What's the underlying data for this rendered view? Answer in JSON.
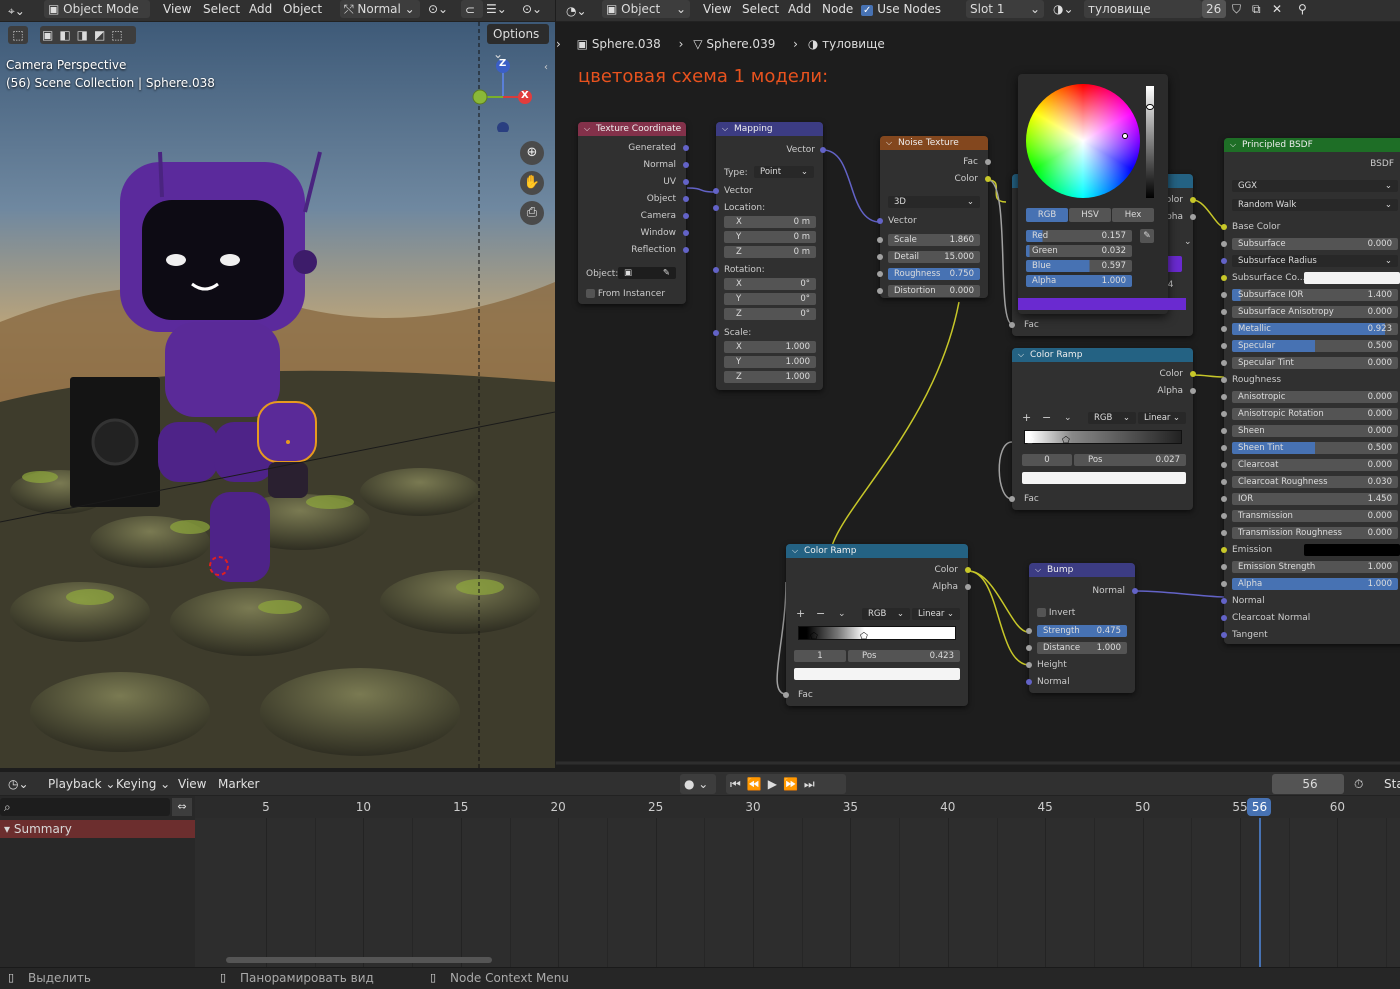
{
  "top_left_menu": {
    "mode": "Object Mode",
    "items": [
      "View",
      "Select",
      "Add",
      "Object"
    ],
    "orientation": "Normal"
  },
  "top_right_menu": {
    "editor": "Object",
    "items": [
      "View",
      "Select",
      "Add",
      "Node"
    ],
    "use_nodes": "Use Nodes",
    "slot": "Slot 1",
    "material": "туловище",
    "users": "26"
  },
  "viewport": {
    "options": "Options",
    "overlay_line1": "Camera Perspective",
    "overlay_line2": "(56) Scene Collection | Sphere.038",
    "gizmo": {
      "z": "Z",
      "x": "X"
    }
  },
  "breadcrumb": {
    "obj1": "Sphere.038",
    "obj2": "Sphere.039",
    "mat": "туловище"
  },
  "annotation": "цветовая схема  1 модели:",
  "nodes": {
    "texcoord": {
      "title": "Texture Coordinate",
      "outputs": [
        "Generated",
        "Normal",
        "UV",
        "Object",
        "Camera",
        "Window",
        "Reflection"
      ],
      "object_label": "Object:",
      "from_instancer": "From Instancer"
    },
    "mapping": {
      "title": "Mapping",
      "out": "Vector",
      "type_label": "Type:",
      "type": "Point",
      "vector": "Vector",
      "location": "Location:",
      "loc": [
        "0 m",
        "0 m",
        "0 m"
      ],
      "rotation": "Rotation:",
      "rot": [
        "0°",
        "0°",
        "0°"
      ],
      "scale": "Scale:",
      "scl": [
        "1.000",
        "1.000",
        "1.000"
      ],
      "axes": [
        "X",
        "Y",
        "Z"
      ]
    },
    "noise": {
      "title": "Noise Texture",
      "fac": "Fac",
      "color": "Color",
      "dim": "3D",
      "vector": "Vector",
      "fields": [
        {
          "l": "Scale",
          "v": "1.860"
        },
        {
          "l": "Detail",
          "v": "15.000"
        },
        {
          "l": "Roughness",
          "v": "0.750"
        },
        {
          "l": "Distortion",
          "v": "0.000"
        }
      ]
    },
    "picker": {
      "tabs": [
        "RGB",
        "HSV",
        "Hex"
      ],
      "chans": [
        {
          "l": "Red",
          "v": "0.157"
        },
        {
          "l": "Green",
          "v": "0.032"
        },
        {
          "l": "Blue",
          "v": "0.597"
        },
        {
          "l": "Alpha",
          "v": "1.000"
        }
      ],
      "peek_out": [
        "Color",
        "Alpha"
      ],
      "fac": "Fac",
      "peek_val": "84",
      "peek_drop": "r"
    },
    "ramp1": {
      "title": "Color Ramp",
      "out": [
        "Color",
        "Alpha"
      ],
      "mode": "RGB",
      "interp": "Linear",
      "idx": "0",
      "pos_label": "Pos",
      "pos": "0.027",
      "fac": "Fac",
      "plus": "+",
      "minus": "−",
      "chev": "⌄"
    },
    "ramp2": {
      "title": "Color Ramp",
      "out": [
        "Color",
        "Alpha"
      ],
      "mode": "RGB",
      "interp": "Linear",
      "idx": "1",
      "pos_label": "Pos",
      "pos": "0.423",
      "fac": "Fac",
      "plus": "+",
      "minus": "−",
      "chev": "⌄"
    },
    "bump": {
      "title": "Bump",
      "normal_out": "Normal",
      "invert": "Invert",
      "fields": [
        {
          "l": "Strength",
          "v": "0.475"
        },
        {
          "l": "Distance",
          "v": "1.000"
        }
      ],
      "height": "Height",
      "normal_in": "Normal"
    },
    "bsdf": {
      "title": "Principled BSDF",
      "out": "BSDF",
      "dist": "GGX",
      "sss": "Random Walk",
      "base": "Base Color",
      "rows": [
        {
          "l": "Subsurface",
          "v": "0.000"
        },
        {
          "l": "Subsurface Radius",
          "v": ""
        },
        {
          "l": "Subsurface Co...",
          "v": ""
        },
        {
          "l": "Subsurface IOR",
          "v": "1.400"
        },
        {
          "l": "Subsurface Anisotropy",
          "v": "0.000"
        },
        {
          "l": "Metallic",
          "v": "0.923"
        },
        {
          "l": "Specular",
          "v": "0.500"
        },
        {
          "l": "Specular Tint",
          "v": "0.000"
        },
        {
          "l": "Roughness",
          "v": ""
        },
        {
          "l": "Anisotropic",
          "v": "0.000"
        },
        {
          "l": "Anisotropic Rotation",
          "v": "0.000"
        },
        {
          "l": "Sheen",
          "v": "0.000"
        },
        {
          "l": "Sheen Tint",
          "v": "0.500"
        },
        {
          "l": "Clearcoat",
          "v": "0.000"
        },
        {
          "l": "Clearcoat Roughness",
          "v": "0.030"
        },
        {
          "l": "IOR",
          "v": "1.450"
        },
        {
          "l": "Transmission",
          "v": "0.000"
        },
        {
          "l": "Transmission Roughness",
          "v": "0.000"
        },
        {
          "l": "Emission",
          "v": ""
        },
        {
          "l": "Emission Strength",
          "v": "1.000"
        },
        {
          "l": "Alpha",
          "v": "1.000"
        },
        {
          "l": "Normal",
          "v": ""
        },
        {
          "l": "Clearcoat Normal",
          "v": ""
        },
        {
          "l": "Tangent",
          "v": ""
        }
      ]
    }
  },
  "timeline": {
    "menus": [
      "Playback",
      "Keying",
      "View",
      "Marker"
    ],
    "frame": "56",
    "start_cut": "Sta",
    "summary": "Summary",
    "ticks": [
      "5",
      "10",
      "15",
      "20",
      "25",
      "30",
      "35",
      "40",
      "45",
      "50",
      "55",
      "60"
    ],
    "current": "56"
  },
  "status": {
    "a": "Выделить",
    "b": "Панорамировать вид",
    "c": "Node Context Menu"
  },
  "colors": {
    "accent": "#4772b3",
    "annotation": "#e8521e",
    "purple": "#6a2ad0"
  }
}
